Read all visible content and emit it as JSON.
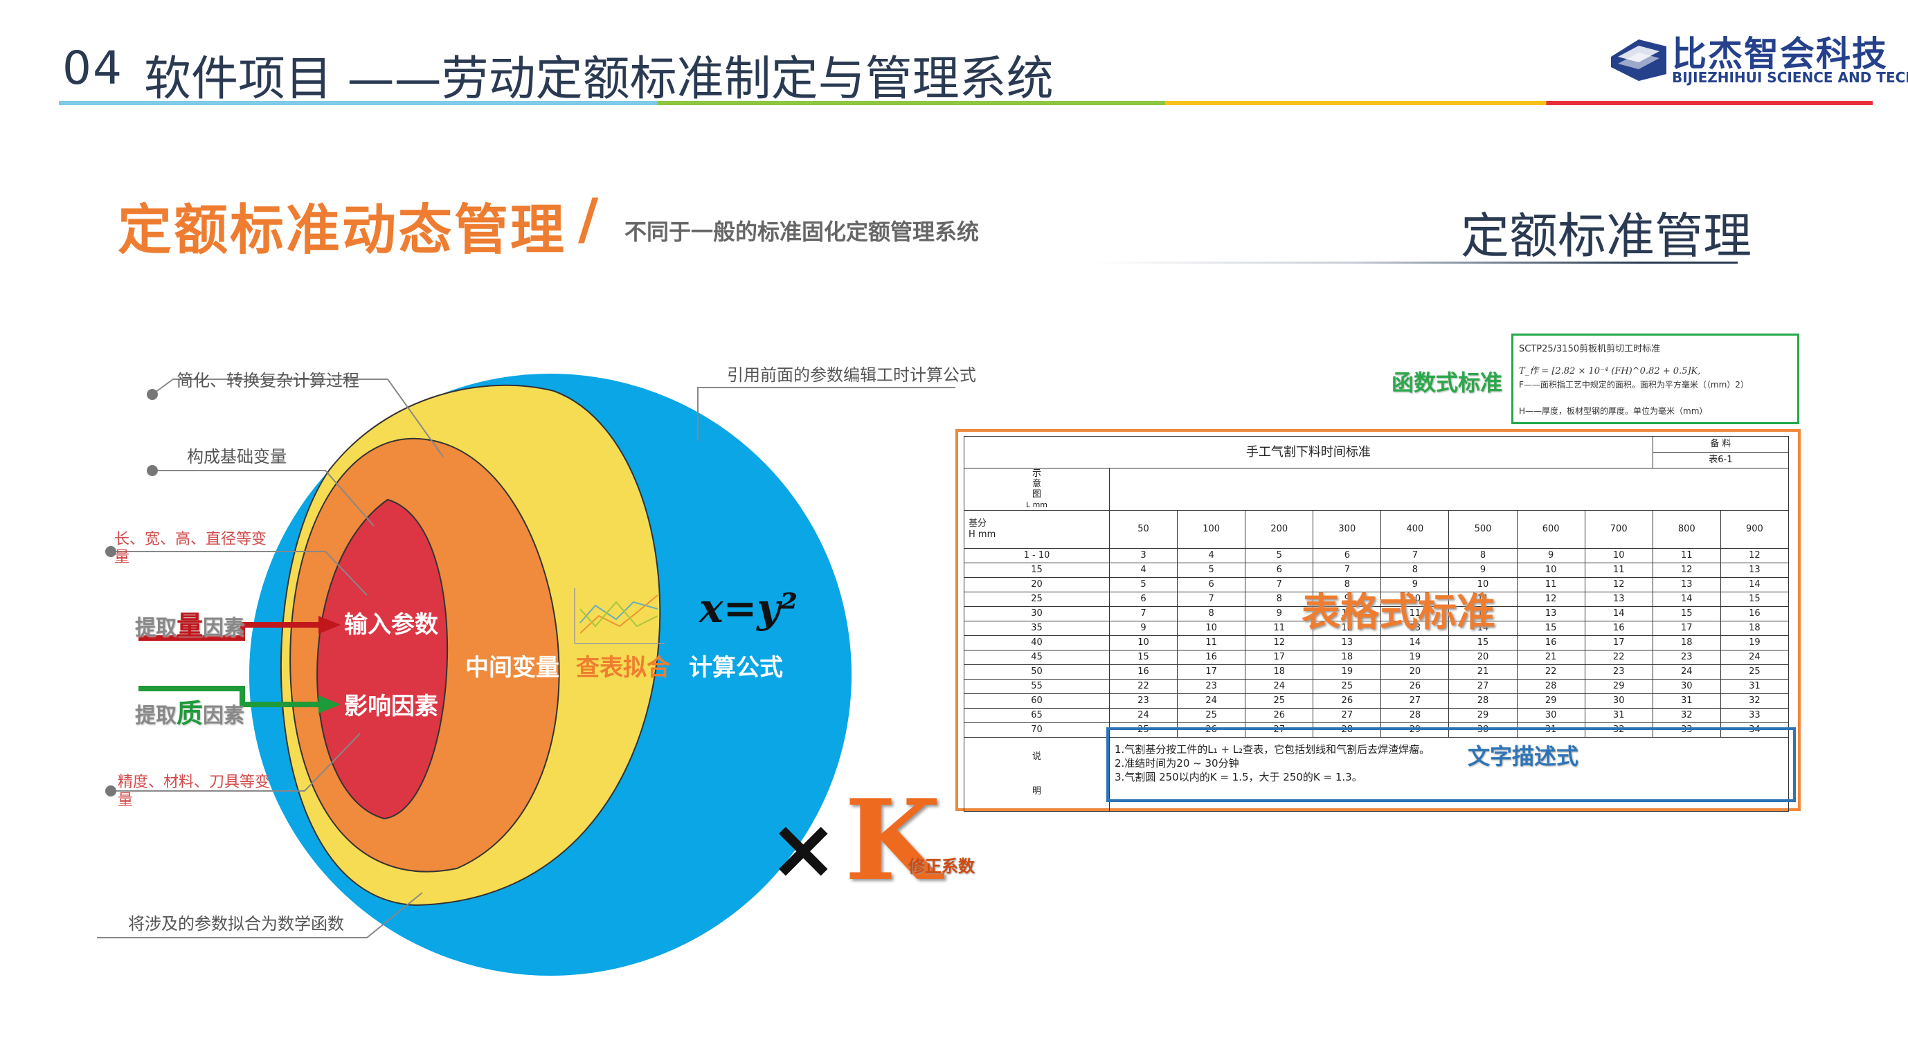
{
  "header": {
    "section_number": "04",
    "title": "软件项目 ——劳动定额标准制定与管理系统",
    "logo_cn": "比杰智会科技",
    "logo_en": "BIJIEZHIHUI SCIENCE AND TECHNOLOGY",
    "bar_colors": [
      "#7fcbe8",
      "#8dc63f",
      "#f8c21c",
      "#e8303a"
    ]
  },
  "section": {
    "title": "定额标准动态管理",
    "slash": "/",
    "subtitle": "不同于一般的标准固化定额管理系统",
    "right_title": "定额标准管理"
  },
  "diagram": {
    "labels": {
      "simplify": "简化、转换复杂计算过程",
      "base_vars": "构成基础变量",
      "dims": "长、宽、高、直径等变量",
      "precision": "精度、材料、刀具等变量",
      "cite": "引用前面的参数编辑工时计算公式",
      "fit": "将涉及的参数拟合为数学函数"
    },
    "extract_qty": {
      "pre": "提取",
      "em": "量",
      "post": "因素"
    },
    "extract_qual": {
      "pre": "提取",
      "em": "质",
      "post": "因素"
    },
    "rings": {
      "input": "输入参数",
      "influence": "影响因素",
      "intermediate": "中间变量",
      "lookup": "查表拟合",
      "formula": "计算公式",
      "formula_glyph": "x=y²"
    },
    "colors": {
      "outer": "#0aa6e6",
      "yellow": "#f6dc52",
      "orange": "#f08a3c",
      "red": "#dc3544",
      "arrow_red": "#c0161c",
      "arrow_green": "#1f9a3a"
    }
  },
  "k_factor": {
    "times": "×",
    "letter": "K",
    "sub": "修正系数"
  },
  "func_standard": {
    "label": "函数式标准",
    "title": "SCTP25/3150剪板机剪切工时标准",
    "formula": "T_作 = [2.82 × 10⁻⁴ (FH)^0.82 + 0.5]K,",
    "line_f": "F——面积指工艺中规定的面积。面积为平方毫米（（mm）2）",
    "line_h": "H——厚度，板材型钢的厚度。单位为毫米（mm）"
  },
  "table_standard": {
    "label": "表格式标准",
    "title": "手工气割下料时间标准",
    "remark": "备 料",
    "table_no": "表6-1",
    "diagram_cell": "示意图",
    "l_mm": "L mm",
    "base_label": "基分",
    "h_mm": "H mm",
    "columns": [
      "50",
      "100",
      "200",
      "300",
      "400",
      "500",
      "600",
      "700",
      "800",
      "900"
    ],
    "rows": [
      {
        "h": "1 - 10",
        "v": [
          "3",
          "4",
          "5",
          "6",
          "7",
          "8",
          "9",
          "10",
          "11",
          "12"
        ]
      },
      {
        "h": "15",
        "v": [
          "4",
          "5",
          "6",
          "7",
          "8",
          "9",
          "10",
          "11",
          "12",
          "13"
        ]
      },
      {
        "h": "20",
        "v": [
          "5",
          "6",
          "7",
          "8",
          "9",
          "10",
          "11",
          "12",
          "13",
          "14"
        ]
      },
      {
        "h": "25",
        "v": [
          "6",
          "7",
          "8",
          "9",
          "10",
          "11",
          "12",
          "13",
          "14",
          "15"
        ]
      },
      {
        "h": "30",
        "v": [
          "7",
          "8",
          "9",
          "10",
          "11",
          "12",
          "13",
          "14",
          "15",
          "16"
        ]
      },
      {
        "h": "35",
        "v": [
          "9",
          "10",
          "11",
          "12",
          "13",
          "14",
          "15",
          "16",
          "17",
          "18"
        ]
      },
      {
        "h": "40",
        "v": [
          "10",
          "11",
          "12",
          "13",
          "14",
          "15",
          "16",
          "17",
          "18",
          "19"
        ]
      },
      {
        "h": "45",
        "v": [
          "15",
          "16",
          "17",
          "18",
          "19",
          "20",
          "21",
          "22",
          "23",
          "24"
        ]
      },
      {
        "h": "50",
        "v": [
          "16",
          "17",
          "18",
          "19",
          "20",
          "21",
          "22",
          "23",
          "24",
          "25"
        ]
      },
      {
        "h": "55",
        "v": [
          "22",
          "23",
          "24",
          "25",
          "26",
          "27",
          "28",
          "29",
          "30",
          "31"
        ]
      },
      {
        "h": "60",
        "v": [
          "23",
          "24",
          "25",
          "26",
          "27",
          "28",
          "29",
          "30",
          "31",
          "32"
        ]
      },
      {
        "h": "65",
        "v": [
          "24",
          "25",
          "26",
          "27",
          "28",
          "29",
          "30",
          "31",
          "32",
          "33"
        ]
      },
      {
        "h": "70",
        "v": [
          "25",
          "26",
          "27",
          "28",
          "29",
          "30",
          "31",
          "32",
          "33",
          "34"
        ]
      }
    ],
    "note_label_1": "说",
    "note_label_2": "明"
  },
  "text_standard": {
    "label": "文字描述式",
    "lines": [
      "1.气割基分按工件的L₁ + L₂查表，它包括划线和气割后去焊渣焊瘤。",
      "2.准结时间为20 ~ 30分钟",
      "3.气割圆 250以内的K = 1.5，大于 250的K = 1.3。"
    ]
  }
}
